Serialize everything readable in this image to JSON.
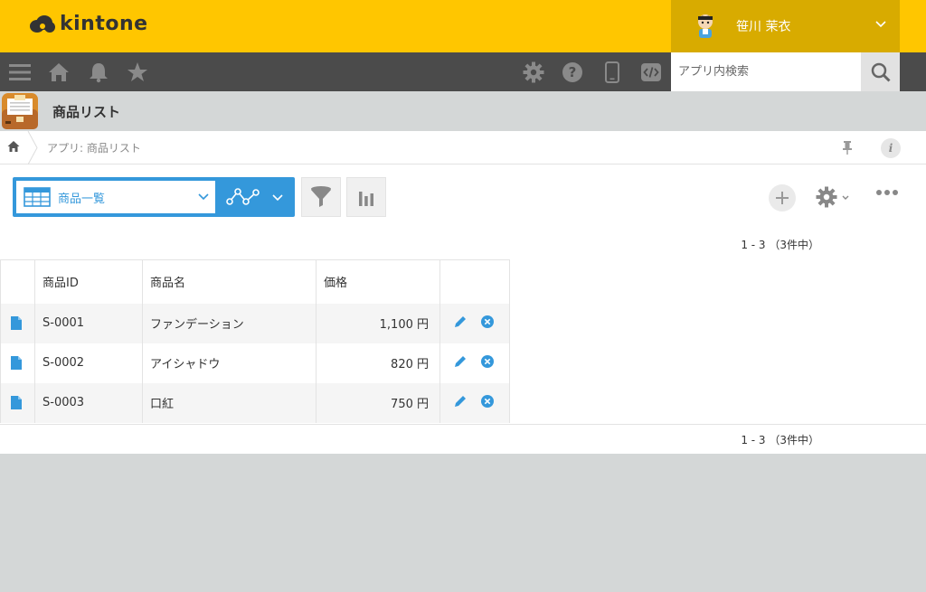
{
  "header": {
    "logo_text": "kintone",
    "user_name": "笹川 茉衣",
    "brand_color": "#ffc600",
    "user_area_color": "#d8ab00"
  },
  "navbar": {
    "icons": [
      "menu-icon",
      "home-icon",
      "bell-icon",
      "star-icon",
      "gear-icon",
      "help-icon",
      "mobile-icon",
      "code-icon"
    ],
    "search_placeholder": "アプリ内検索"
  },
  "app": {
    "name": "商品リスト"
  },
  "breadcrumb": {
    "text": "アプリ: 商品リスト"
  },
  "toolbar": {
    "view_name": "商品一覧",
    "accent_color": "#3498db"
  },
  "pager": {
    "top": "1 - 3 （3件中）",
    "bottom": "1 - 3 （3件中）"
  },
  "table": {
    "headers": [
      "商品ID",
      "商品名",
      "価格"
    ],
    "rows": [
      {
        "id": "S-0001",
        "name": "ファンデーション",
        "price": "1,100 円"
      },
      {
        "id": "S-0002",
        "name": "アイシャドウ",
        "price": "820 円"
      },
      {
        "id": "S-0003",
        "name": "口紅",
        "price": "750 円"
      }
    ]
  }
}
